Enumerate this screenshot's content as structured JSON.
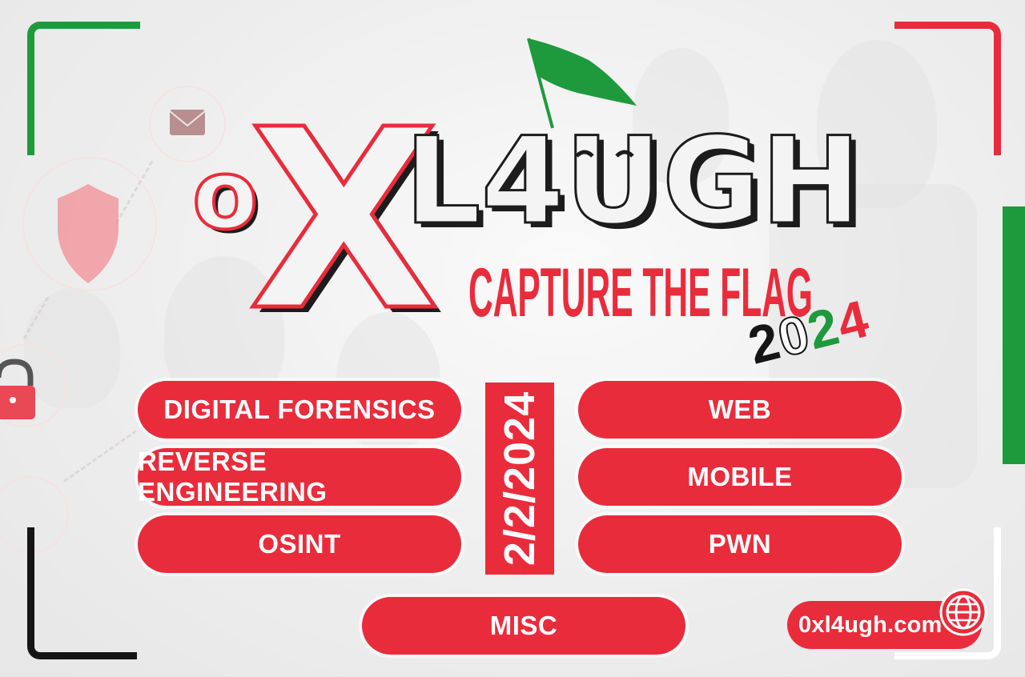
{
  "brand": {
    "logo_prefix": "oX",
    "logo_suffix": "L4UGH",
    "subtitle": "CAPTURE THE FLAG",
    "year_digits": [
      "2",
      "0",
      "2",
      "4"
    ]
  },
  "event": {
    "date": "2/2/2024"
  },
  "categories": {
    "left": [
      "DIGITAL FORENSICS",
      "REVERSE ENGINEERING",
      "OSINT"
    ],
    "right": [
      "WEB",
      "MOBILE",
      "PWN"
    ],
    "bottom": "MISC"
  },
  "website": {
    "url": "0xl4ugh.com",
    "icon": "globe-icon"
  },
  "colors": {
    "red": "#e92c3b",
    "green": "#1e9a3c",
    "black": "#151515",
    "white": "#ffffff"
  }
}
